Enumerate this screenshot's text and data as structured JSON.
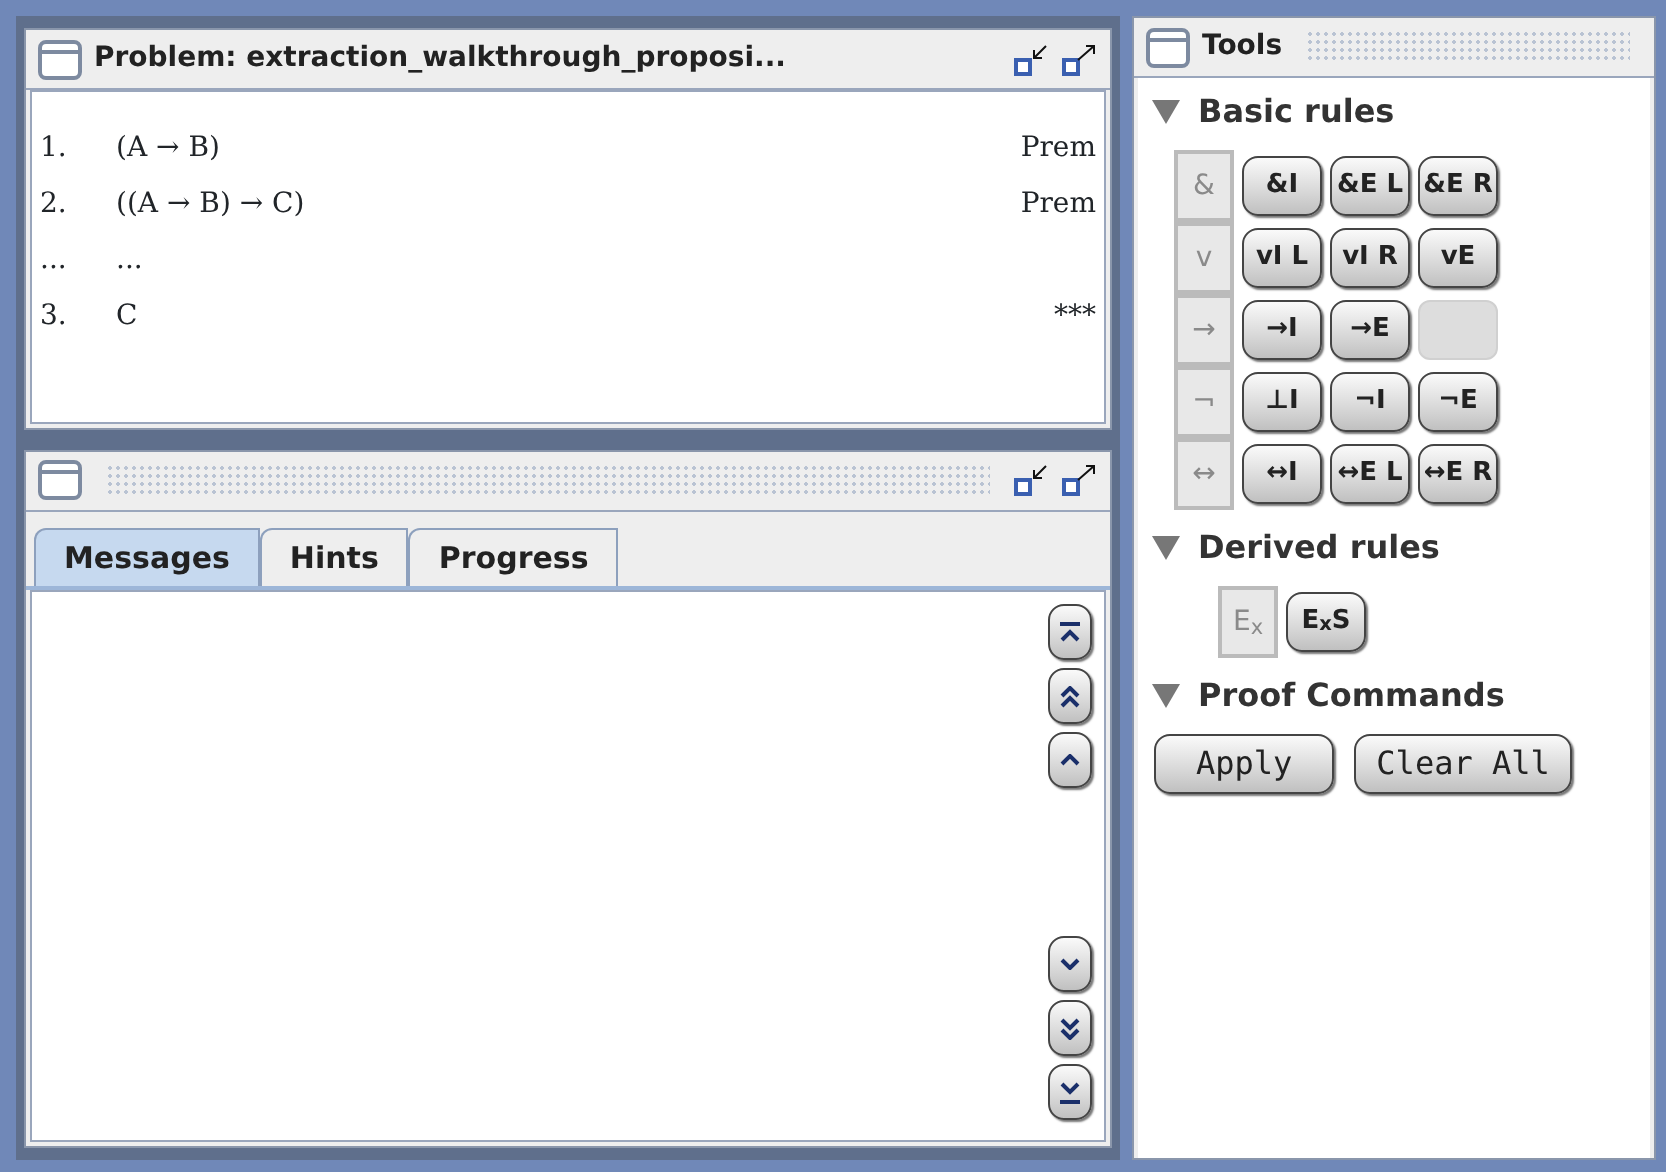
{
  "problem_window": {
    "title": "Problem: extraction_walkthrough_proposi...",
    "lines": [
      {
        "number": "1.",
        "formula": "(A → B)",
        "justification": "Prem"
      },
      {
        "number": "2.",
        "formula": "((A → B) → C)",
        "justification": "Prem"
      },
      {
        "number": "...",
        "formula": "..."
      },
      {
        "number": "3.",
        "formula": "C",
        "justification": "***"
      }
    ]
  },
  "message_window": {
    "tabs": [
      {
        "label": "Messages",
        "selected": true
      },
      {
        "label": "Hints",
        "selected": false
      },
      {
        "label": "Progress",
        "selected": false
      }
    ],
    "scroll_buttons": [
      {
        "kind": "top"
      },
      {
        "kind": "page-up"
      },
      {
        "kind": "up"
      },
      {
        "kind": "down"
      },
      {
        "kind": "page-down"
      },
      {
        "kind": "bottom"
      }
    ]
  },
  "tools": {
    "title": "Tools",
    "sections": [
      {
        "kind": "rules",
        "title": "Basic rules",
        "expanded": true,
        "rows": [
          {
            "symbol": "&",
            "buttons": [
              {
                "label": "&I"
              },
              {
                "label": "&E L"
              },
              {
                "label": "&E R"
              }
            ]
          },
          {
            "symbol": "v",
            "buttons": [
              {
                "label": "vI L"
              },
              {
                "label": "vI R"
              },
              {
                "label": "vE"
              }
            ]
          },
          {
            "symbol": "→",
            "buttons": [
              {
                "label": "→I"
              },
              {
                "label": "→E"
              },
              {
                "kind": "blank"
              }
            ]
          },
          {
            "symbol": "¬",
            "buttons": [
              {
                "label": "⊥I"
              },
              {
                "label": "¬I"
              },
              {
                "label": "¬E"
              }
            ]
          },
          {
            "symbol": "↔",
            "buttons": [
              {
                "label": "↔I"
              },
              {
                "label": "↔E L"
              },
              {
                "label": "↔E R"
              }
            ]
          }
        ]
      },
      {
        "kind": "rules",
        "title": "Derived rules",
        "expanded": true,
        "rows": [
          {
            "symbol": "E$_{x}$",
            "buttons": [
              {
                "label": "E$_{x}$S"
              }
            ]
          }
        ]
      },
      {
        "kind": "commands",
        "title": "Proof Commands",
        "expanded": true,
        "buttons": [
          {
            "label": "Apply"
          },
          {
            "label": "Clear All"
          }
        ]
      }
    ]
  }
}
